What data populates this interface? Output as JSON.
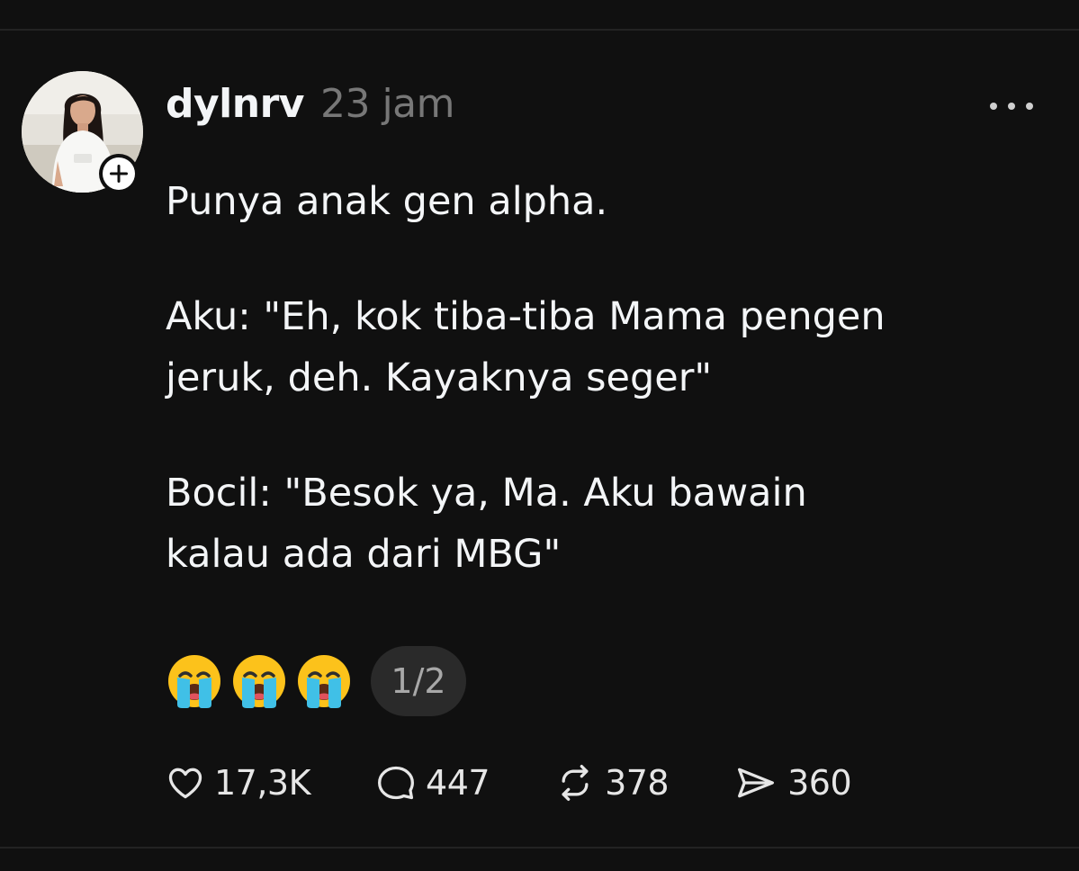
{
  "post": {
    "username": "dylnrv",
    "timestamp": "23 jam",
    "body": [
      "Punya anak gen alpha.",
      "Aku: \"Eh, kok tiba-tiba Mama pengen\njeruk, deh. Kayaknya seger\"",
      "Bocil: \"Besok ya, Ma. Aku bawain\nkalau ada dari MBG\""
    ],
    "emojis": [
      "crying-face-icon",
      "crying-face-icon",
      "crying-face-icon"
    ],
    "page_indicator": "1/2"
  },
  "actions": {
    "likes": "17,3K",
    "comments": "447",
    "reposts": "378",
    "shares": "360"
  },
  "icons": {
    "follow": "plus-icon",
    "more": "more-horizontal-icon",
    "like": "heart-icon",
    "comment": "speech-bubble-icon",
    "repost": "repost-icon",
    "share": "send-icon"
  },
  "colors": {
    "background": "#101010",
    "text": "#f3f5f7",
    "muted": "#777777",
    "pill": "#2a2a2a"
  }
}
